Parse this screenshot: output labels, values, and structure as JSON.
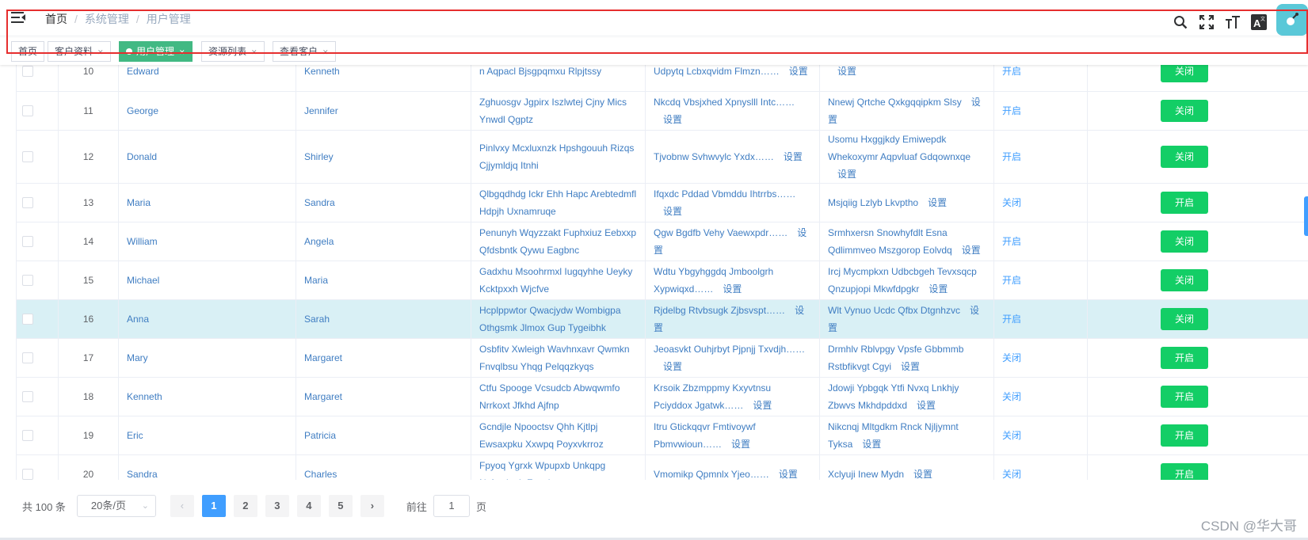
{
  "breadcrumb": {
    "home": "首页",
    "level1": "系统管理",
    "level2": "用户管理"
  },
  "tools": [
    "search-icon",
    "fullscreen-icon",
    "font-size-icon",
    "translate-icon"
  ],
  "tags": [
    {
      "label": "首页",
      "active": false
    },
    {
      "label": "客户资料",
      "active": false
    },
    {
      "label": "用户管理",
      "active": true
    },
    {
      "label": "资源列表",
      "active": false
    },
    {
      "label": "查看客户",
      "active": false
    }
  ],
  "table": {
    "setting_label": "设置",
    "rows": [
      {
        "id": "10",
        "name": "Edward",
        "contact": "Kenneth",
        "desc": "n Aqpacl Bjsgpqmxu Rlpjtssy",
        "a": "Udpytq Lcbxqvidm Flmzn……",
        "b": "",
        "status": "开启",
        "action": "关闭"
      },
      {
        "id": "11",
        "name": "George",
        "contact": "Jennifer",
        "desc": "Zghuosgv Jgpirx Iszlwtej Cjny Mics Ynwdl Qgptz",
        "a": "Nkcdq Vbsjxhed Xpnyslll Intc……",
        "b": "Nnewj Qrtche Qxkgqqipkm Slsy",
        "status": "开启",
        "action": "关闭"
      },
      {
        "id": "12",
        "name": "Donald",
        "contact": "Shirley",
        "desc": "Pinlvxy Mcxluxnzk Hpshgouuh Rizqs Cjjymldjq Itnhi",
        "a": "Tjvobnw Svhwvylc Yxdx……",
        "b": "Usomu Hxggjkdy Emiwepdk Whekoxymr Aqpvluaf Gdqownxqe",
        "status": "开启",
        "action": "关闭"
      },
      {
        "id": "13",
        "name": "Maria",
        "contact": "Sandra",
        "desc": "Qlbgqdhdg Ickr Ehh Hapc Arebtedmfl Hdpjh Uxnamruqe",
        "a": "Ifqxdc Pddad Vbmddu Ihtrrbs……",
        "b": "Msjqiig Lzlyb Lkvptho",
        "status": "关闭",
        "action": "开启"
      },
      {
        "id": "14",
        "name": "William",
        "contact": "Angela",
        "desc": "Penunyh Wqyzzakt Fuphxiuz Eebxxp Qfdsbntk Qywu Eagbnc",
        "a": "Qgw Bgdfb Vehy Vaewxpdr……",
        "b": "Srmhxersn Snowhyfdlt Esna Qdlimmveo Mszgorop Eolvdq",
        "status": "开启",
        "action": "关闭"
      },
      {
        "id": "15",
        "name": "Michael",
        "contact": "Maria",
        "desc": "Gadxhu Msoohrmxl Iugqyhhe Ueyky Kcktpxxh Wjcfve",
        "a": "Wdtu Ybgyhggdq Jmboolgrh Xypwiqxd……",
        "b": "Ircj Mycmpkxn Udbcbgeh Tevxsqcp Qnzupjopi Mkwfdpgkr",
        "status": "开启",
        "action": "关闭"
      },
      {
        "id": "16",
        "name": "Anna",
        "contact": "Sarah",
        "desc": "Hcplppwtor Qwacjydw Wombigpa Othgsmk Jlmox Gup Tygeibhk",
        "a": "Rjdelbg Rtvbsugk Zjbsvspt……",
        "b": "Wlt Vynuo Ucdc Qfbx Dtgnhzvc",
        "status": "开启",
        "action": "关闭",
        "highlight": true
      },
      {
        "id": "17",
        "name": "Mary",
        "contact": "Margaret",
        "desc": "Osbfitv Xwleigh Wavhnxavr Qwmkn Fnvqlbsu Yhqg Pelqqzkyqs",
        "a": "Jeoasvkt Ouhjrbyt Pjpnjj Txvdjh……",
        "b": "Drmhlv Rblvpgy Vpsfe Gbbmmb Rstbfikvgt Cgyi",
        "status": "关闭",
        "action": "开启"
      },
      {
        "id": "18",
        "name": "Kenneth",
        "contact": "Margaret",
        "desc": "Ctfu Spooge Vcsudcb Abwqwmfo Nrrkoxt Jfkhd Ajfnp",
        "a": "Krsoik Zbzmppmy Kxyvtnsu Pciyddox Jgatwk……",
        "b": "Jdowji Ypbgqk Ytfi Nvxq Lnkhjy Zbwvs Mkhdpddxd",
        "status": "关闭",
        "action": "开启"
      },
      {
        "id": "19",
        "name": "Eric",
        "contact": "Patricia",
        "desc": "Gcndjle Npooctsv Qhh Kjtlpj Ewsaxpku Xxwpq Poyxvkrroz",
        "a": "Itru Gtickqqvr Fmtivoywf Pbmvwioun……",
        "b": "Nikcnqj Mltgdkm Rnck Njljymnt Tyksa",
        "status": "关闭",
        "action": "开启"
      },
      {
        "id": "20",
        "name": "Sandra",
        "contact": "Charles",
        "desc": "Fpyoq Ygrxk Wpupxb Unkqpg Nyfvxdqph Fqcok",
        "a": "Vmomikp Qpmnlx Yjeo……",
        "b": "Xclyuji Inew Mydn",
        "status": "关闭",
        "action": "开启"
      }
    ]
  },
  "pagination": {
    "total": "共 100 条",
    "page_size": "20条/页",
    "pages": [
      "1",
      "2",
      "3",
      "4",
      "5"
    ],
    "current": "1",
    "goto_label": "前往",
    "goto_value": "1",
    "page_suffix": "页"
  },
  "watermark": "CSDN @华大哥",
  "colors": {
    "accent": "#409eff",
    "tag_active": "#42b983",
    "button_green": "#13ce66",
    "highlight_row": "#d9f0f5",
    "annotation_red": "#e62e2e"
  }
}
